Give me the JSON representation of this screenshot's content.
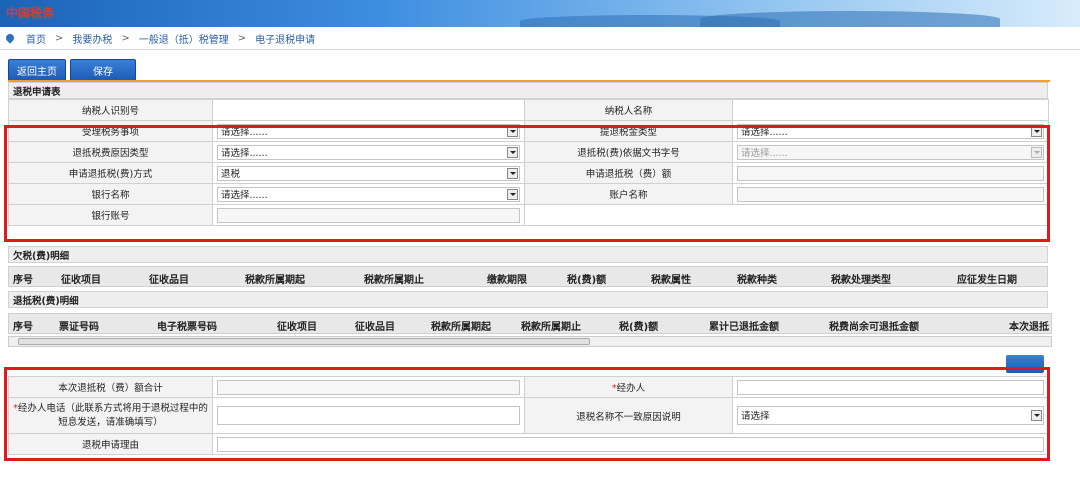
{
  "header": {
    "logo_text": "中国税务"
  },
  "breadcrumb": [
    "首页",
    "我要办税",
    "一般退（抵）税管理",
    "电子退税申请"
  ],
  "breadcrumb_sep": ">",
  "toolbar": {
    "back_label": "返回主页",
    "save_label": "保存"
  },
  "form": {
    "section_title": "退税申请表",
    "labels": {
      "taxpayer_id": "纳税人识别号",
      "taxpayer_name": "纳税人名称",
      "matter": "受理税务事项",
      "refund_type": "提退税金类型",
      "reason_type": "退抵税费原因类型",
      "doc_number": "退抵税(费)依据文书字号",
      "method": "申请退抵税(费)方式",
      "amount": "申请退抵税（费）额",
      "bank_name": "银行名称",
      "account_name": "账户名称",
      "bank_account": "银行账号"
    },
    "values": {
      "matter": "请选择......",
      "refund_type": "请选择......",
      "reason_type": "请选择......",
      "doc_number": "请选择......",
      "method": "退税",
      "bank_name": "请选择......"
    }
  },
  "owed": {
    "title": "欠税(费)明细",
    "columns": [
      "序号",
      "征收项目",
      "征收品目",
      "税款所属期起",
      "税款所属期止",
      "缴款期限",
      "税(费)额",
      "税款属性",
      "税款种类",
      "税款处理类型",
      "应征发生日期"
    ]
  },
  "refund_detail": {
    "title": "退抵税(费)明细",
    "columns": [
      "序号",
      "票证号码",
      "电子税票号码",
      "征收项目",
      "征收品目",
      "税款所属期起",
      "税款所属期止",
      "税(费)额",
      "累计已退抵金额",
      "税费尚余可退抵金额",
      "本次退抵"
    ]
  },
  "bottom": {
    "labels": {
      "total": "本次退抵税（费）额合计",
      "agent": "经办人",
      "agent_phone_line1": "经办人电话（此联系方式将用于退税过程中的",
      "agent_phone_line2": "短息发送，请准确填写）",
      "mismatch": "退税名称不一致原因说明",
      "reason": "退税申请理由"
    },
    "required_mark": "*",
    "mismatch_value": "请选择"
  },
  "colors": {
    "accent": "#f0a030",
    "highlight": "#e01a1a",
    "link": "#2c5fa8",
    "button": "#1c5cb7"
  }
}
